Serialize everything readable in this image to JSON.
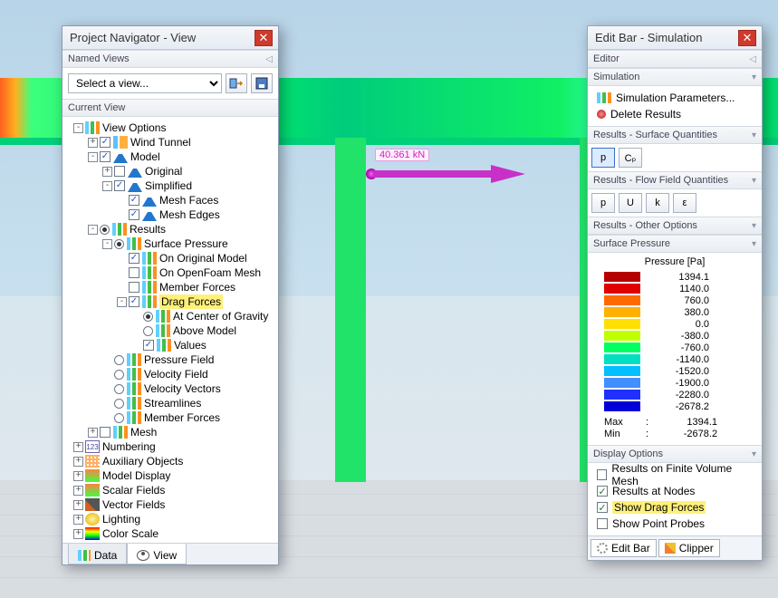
{
  "leftPanel": {
    "title": "Project Navigator - View",
    "namedViewsHeader": "Named Views",
    "selectPlaceholder": "Select a view...",
    "currentViewHeader": "Current View",
    "tabs": {
      "data": "Data",
      "view": "View"
    }
  },
  "tree": [
    {
      "d": 0,
      "tw": "-",
      "ck": null,
      "ic": "bars",
      "label": "View Options"
    },
    {
      "d": 1,
      "tw": "+",
      "ck": true,
      "ic": "b2",
      "label": "Wind Tunnel"
    },
    {
      "d": 1,
      "tw": "-",
      "ck": true,
      "ic": "tri",
      "label": "Model"
    },
    {
      "d": 2,
      "tw": "+",
      "ck": false,
      "ic": "tri",
      "label": "Original"
    },
    {
      "d": 2,
      "tw": "-",
      "ck": true,
      "ic": "tri",
      "label": "Simplified"
    },
    {
      "d": 3,
      "tw": " ",
      "ck": true,
      "ic": "tri",
      "label": "Mesh Faces"
    },
    {
      "d": 3,
      "tw": " ",
      "ck": true,
      "ic": "tri",
      "label": "Mesh Edges"
    },
    {
      "d": 1,
      "tw": "-",
      "rd": "on",
      "ic": "bars",
      "label": "Results"
    },
    {
      "d": 2,
      "tw": "-",
      "rd": "on",
      "ic": "bars",
      "label": "Surface Pressure"
    },
    {
      "d": 3,
      "tw": " ",
      "ck": true,
      "ic": "bars",
      "label": "On Original Model"
    },
    {
      "d": 3,
      "tw": " ",
      "ck": false,
      "ic": "bars",
      "label": "On OpenFoam Mesh"
    },
    {
      "d": 3,
      "tw": " ",
      "ck": false,
      "ic": "bars",
      "label": "Member Forces"
    },
    {
      "d": 3,
      "tw": "-",
      "ck": true,
      "ic": "bars",
      "label": "Drag Forces",
      "hl": true
    },
    {
      "d": 4,
      "tw": " ",
      "rd": "on",
      "ic": "bars",
      "label": "At Center of Gravity"
    },
    {
      "d": 4,
      "tw": " ",
      "rd": "off",
      "ic": "bars",
      "label": "Above Model"
    },
    {
      "d": 4,
      "tw": " ",
      "ck": true,
      "ic": "bars",
      "label": "Values"
    },
    {
      "d": 2,
      "tw": " ",
      "rd": "off",
      "ic": "bars",
      "label": "Pressure Field"
    },
    {
      "d": 2,
      "tw": " ",
      "rd": "off",
      "ic": "bars",
      "label": "Velocity Field"
    },
    {
      "d": 2,
      "tw": " ",
      "rd": "off",
      "ic": "bars",
      "label": "Velocity Vectors"
    },
    {
      "d": 2,
      "tw": " ",
      "rd": "off",
      "ic": "bars",
      "label": "Streamlines"
    },
    {
      "d": 2,
      "tw": " ",
      "rd": "off",
      "ic": "bars",
      "label": "Member Forces"
    },
    {
      "d": 1,
      "tw": "+",
      "ck": false,
      "ic": "bars",
      "label": "Mesh"
    },
    {
      "d": 0,
      "tw": "+",
      "ck": null,
      "ic": "num",
      "label": "Numbering"
    },
    {
      "d": 0,
      "tw": "+",
      "ck": null,
      "ic": "grid",
      "label": "Auxiliary Objects"
    },
    {
      "d": 0,
      "tw": "+",
      "ck": null,
      "ic": "disp",
      "label": "Model Display"
    },
    {
      "d": 0,
      "tw": "+",
      "ck": null,
      "ic": "disp",
      "label": "Scalar Fields"
    },
    {
      "d": 0,
      "tw": "+",
      "ck": null,
      "ic": "vec",
      "label": "Vector Fields"
    },
    {
      "d": 0,
      "tw": "+",
      "ck": null,
      "ic": "bulb",
      "label": "Lighting"
    },
    {
      "d": 0,
      "tw": "+",
      "ck": null,
      "ic": "scale",
      "label": "Color Scale"
    }
  ],
  "rightPanel": {
    "title": "Edit Bar - Simulation",
    "editor": "Editor",
    "simulation": "Simulation",
    "simItems": [
      "Simulation Parameters...",
      "Delete Results"
    ],
    "surfQ": "Results - Surface Quantities",
    "surfBtns": [
      "p",
      "Cₚ"
    ],
    "flowQ": "Results - Flow Field Quantities",
    "flowBtns": [
      "p",
      "U",
      "k",
      "ε"
    ],
    "otherOpt": "Results - Other Options",
    "surfPress": "Surface Pressure",
    "legendTitle": "Pressure [Pa]",
    "legend": [
      {
        "c": "#b60000",
        "v": "1394.1"
      },
      {
        "c": "#e00000",
        "v": "1140.0"
      },
      {
        "c": "#ff6a00",
        "v": "760.0"
      },
      {
        "c": "#ffb000",
        "v": "380.0"
      },
      {
        "c": "#ffe000",
        "v": "0.0"
      },
      {
        "c": "#c0ff00",
        "v": "-380.0"
      },
      {
        "c": "#00ff60",
        "v": "-760.0"
      },
      {
        "c": "#00e0c0",
        "v": "-1140.0"
      },
      {
        "c": "#00c0ff",
        "v": "-1520.0"
      },
      {
        "c": "#4090ff",
        "v": "-1900.0"
      },
      {
        "c": "#2030ff",
        "v": "-2280.0"
      },
      {
        "c": "#0000d8",
        "v": "-2678.2"
      }
    ],
    "maxLabel": "Max",
    "maxVal": "1394.1",
    "minLabel": "Min",
    "minVal": "-2678.2",
    "dispOpt": "Display Options",
    "dispItems": [
      {
        "on": false,
        "label": "Results on Finite Volume Mesh"
      },
      {
        "on": true,
        "label": "Results at Nodes"
      },
      {
        "on": true,
        "label": "Show Drag Forces",
        "hl": true
      },
      {
        "on": false,
        "label": "Show Point Probes"
      }
    ],
    "bottom": {
      "editBar": "Edit Bar",
      "clipper": "Clipper"
    }
  },
  "arrowLabel": "40.361 kN"
}
